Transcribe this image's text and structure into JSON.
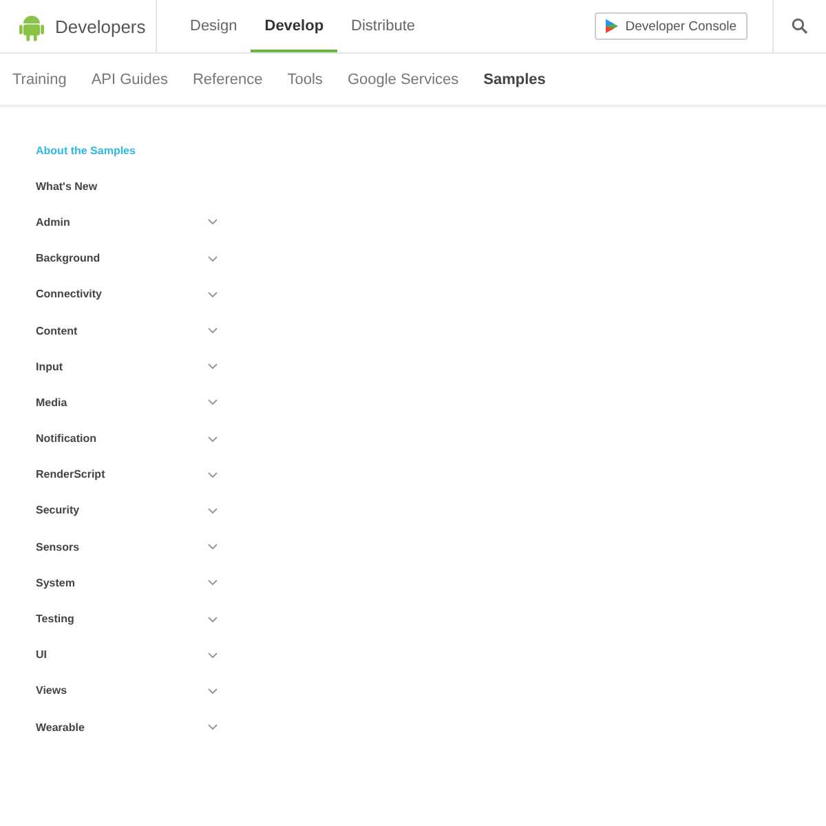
{
  "brand": {
    "name": "Developers"
  },
  "top_tabs": [
    {
      "label": "Design",
      "selected": false
    },
    {
      "label": "Develop",
      "selected": true
    },
    {
      "label": "Distribute",
      "selected": false
    }
  ],
  "console_button": {
    "label": "Developer Console"
  },
  "sub_tabs": [
    {
      "label": "Training",
      "selected": false
    },
    {
      "label": "API Guides",
      "selected": false
    },
    {
      "label": "Reference",
      "selected": false
    },
    {
      "label": "Tools",
      "selected": false
    },
    {
      "label": "Google Services",
      "selected": false
    },
    {
      "label": "Samples",
      "selected": true
    }
  ],
  "sidebar": {
    "items": [
      {
        "label": "About the Samples",
        "selected": true,
        "expandable": false
      },
      {
        "label": "What's New",
        "selected": false,
        "expandable": false
      },
      {
        "label": "Admin",
        "selected": false,
        "expandable": true
      },
      {
        "label": "Background",
        "selected": false,
        "expandable": true
      },
      {
        "label": "Connectivity",
        "selected": false,
        "expandable": true
      },
      {
        "label": "Content",
        "selected": false,
        "expandable": true
      },
      {
        "label": "Input",
        "selected": false,
        "expandable": true
      },
      {
        "label": "Media",
        "selected": false,
        "expandable": true
      },
      {
        "label": "Notification",
        "selected": false,
        "expandable": true
      },
      {
        "label": "RenderScript",
        "selected": false,
        "expandable": true
      },
      {
        "label": "Security",
        "selected": false,
        "expandable": true
      },
      {
        "label": "Sensors",
        "selected": false,
        "expandable": true
      },
      {
        "label": "System",
        "selected": false,
        "expandable": true
      },
      {
        "label": "Testing",
        "selected": false,
        "expandable": true
      },
      {
        "label": "UI",
        "selected": false,
        "expandable": true
      },
      {
        "label": "Views",
        "selected": false,
        "expandable": true
      },
      {
        "label": "Wearable",
        "selected": false,
        "expandable": true
      }
    ]
  }
}
